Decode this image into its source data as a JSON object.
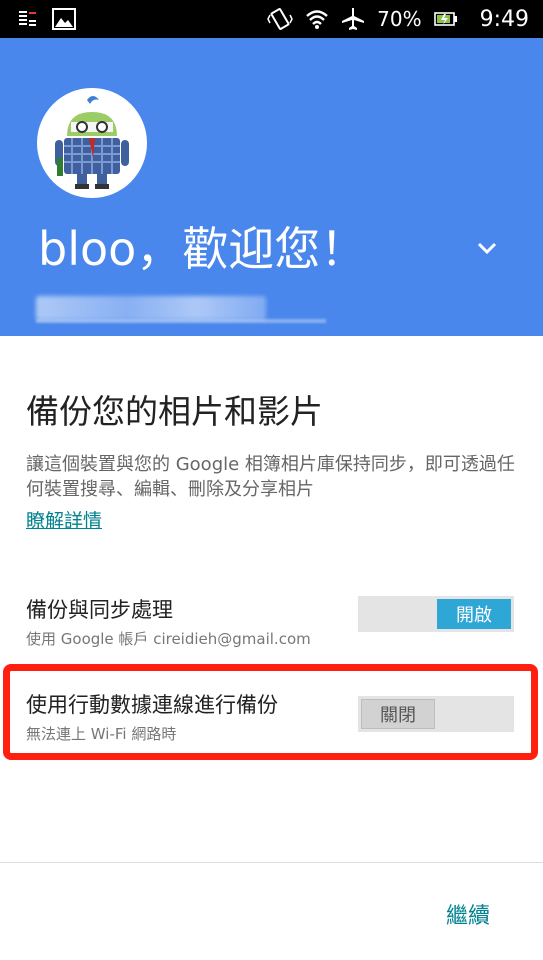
{
  "status_bar": {
    "battery": "70%",
    "time": "9:49",
    "icons": [
      "notification-icon",
      "image-icon",
      "vibrate-icon",
      "wifi-icon",
      "airplane-icon",
      "battery-icon"
    ]
  },
  "header": {
    "welcome": "bloo，歡迎您！",
    "background_color": "#4a87ec"
  },
  "backup": {
    "title": "備份您的相片和影片",
    "description": "讓這個裝置與您的 Google 相簿相片庫保持同步，即可透過任何裝置搜尋、編輯、刪除及分享相片",
    "learn_more": "瞭解詳情"
  },
  "settings": [
    {
      "title": "備份與同步處理",
      "subtitle": "使用 Google 帳戶 cireidieh@gmail.com",
      "toggle_label": "開啟",
      "state": "on"
    },
    {
      "title": "使用行動數據連線進行備份",
      "subtitle": "無法連上 Wi-Fi 網路時",
      "toggle_label": "關閉",
      "state": "off"
    }
  ],
  "footer": {
    "continue_label": "繼續"
  },
  "colors": {
    "accent": "#00838f",
    "toggle_on": "#2fa7d6",
    "highlight": "#ff1f0e"
  }
}
